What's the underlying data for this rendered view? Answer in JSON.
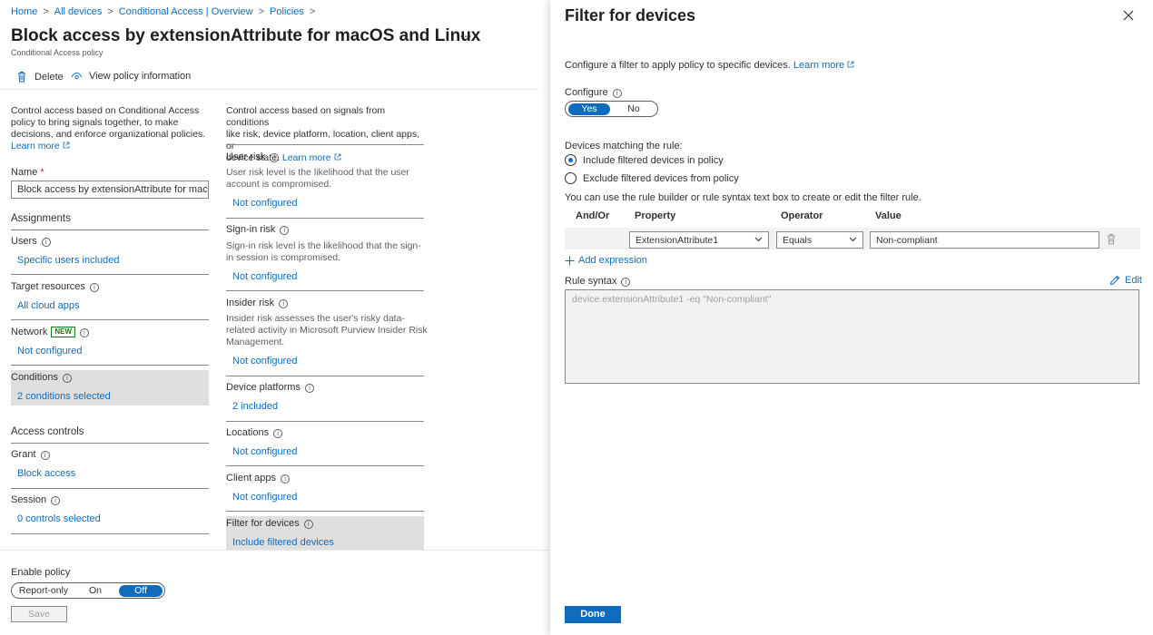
{
  "breadcrumb": [
    "Home",
    "All devices",
    "Conditional Access | Overview",
    "Policies"
  ],
  "page": {
    "title": "Block access by extensionAttribute for macOS and Linux",
    "more": "···",
    "subtitle": "Conditional Access policy"
  },
  "toolbar": {
    "delete_label": "Delete",
    "view_info_label": "View policy information"
  },
  "left_desc": {
    "line1": "Control access based on Conditional Access",
    "line2": "policy to bring signals together, to make",
    "line3": "decisions, and enforce organizational policies.",
    "learn_more": "Learn more"
  },
  "name": {
    "label": "Name",
    "required": "*",
    "value": "Block access by extensionAttribute for mac..."
  },
  "assignments": {
    "heading": "Assignments",
    "users": {
      "label": "Users",
      "value": "Specific users included"
    },
    "target_resources": {
      "label": "Target resources",
      "value": "All cloud apps"
    },
    "network": {
      "label": "Network",
      "badge": "NEW",
      "value": "Not configured"
    },
    "conditions": {
      "label": "Conditions",
      "value": "2 conditions selected"
    }
  },
  "access_controls": {
    "heading": "Access controls",
    "grant": {
      "label": "Grant",
      "value": "Block access"
    },
    "session": {
      "label": "Session",
      "value": "0 controls selected"
    }
  },
  "mid_desc": {
    "line1": "Control access based on signals from conditions",
    "line2": "like risk, device platform, location, client apps, or",
    "line3": "device state.",
    "learn_more": "Learn more"
  },
  "conditions": {
    "user_risk": {
      "label": "User risk",
      "desc1": "User risk level is the likelihood that the user",
      "desc2": "account is compromised.",
      "value": "Not configured"
    },
    "signin_risk": {
      "label": "Sign-in risk",
      "desc1": "Sign-in risk level is the likelihood that the sign-",
      "desc2": "in session is compromised.",
      "value": "Not configured"
    },
    "insider_risk": {
      "label": "Insider risk",
      "desc1": "Insider risk assesses the user's risky data-",
      "desc2": "related activity in Microsoft Purview Insider Risk",
      "desc3": "Management.",
      "value": "Not configured"
    },
    "device_platforms": {
      "label": "Device platforms",
      "value": "2 included"
    },
    "locations": {
      "label": "Locations",
      "value": "Not configured"
    },
    "client_apps": {
      "label": "Client apps",
      "value": "Not configured"
    },
    "filter_devices": {
      "label": "Filter for devices",
      "value": "Include filtered devices"
    }
  },
  "enable_policy": {
    "label": "Enable policy",
    "options": [
      "Report-only",
      "On",
      "Off"
    ],
    "selected": "Off",
    "save_label": "Save"
  },
  "panel": {
    "title": "Filter for devices",
    "intro": "Configure a filter to apply policy to specific devices.",
    "learn_more": "Learn more",
    "configure_label": "Configure",
    "configure_options": [
      "Yes",
      "No"
    ],
    "configure_selected": "Yes",
    "matching_label": "Devices matching the rule:",
    "radio_include": "Include filtered devices in policy",
    "radio_exclude": "Exclude filtered devices from policy",
    "radio_selected": "include",
    "builder_help": "You can use the rule builder or rule syntax text box to create or edit the filter rule.",
    "columns": [
      "And/Or",
      "Property",
      "Operator",
      "Value"
    ],
    "rule": {
      "property": "ExtensionAttribute1",
      "operator": "Equals",
      "value": "Non-compliant"
    },
    "add_expression": "Add expression",
    "rule_syntax_label": "Rule syntax",
    "edit_label": "Edit",
    "rule_syntax_value": "device.extensionAttribute1 -eq \"Non-compliant\"",
    "done_label": "Done"
  },
  "colors": {
    "accent": "#0f6cbd",
    "selected_row": "#e1dfdd",
    "new_badge": "#107c10"
  }
}
